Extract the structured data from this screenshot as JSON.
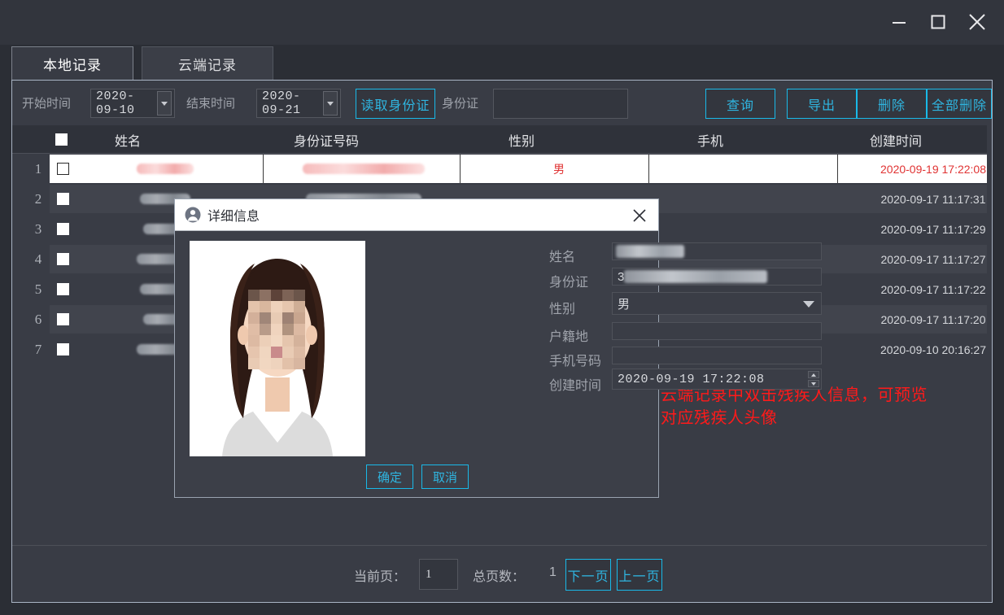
{
  "window": {
    "minimize_label": "—",
    "maximize_label": "□",
    "close_label": "✕"
  },
  "tabs": [
    {
      "label": "本地记录",
      "active": true
    },
    {
      "label": "云端记录",
      "active": false
    }
  ],
  "filter": {
    "start_label": "开始时间",
    "start_value": "2020-09-10",
    "end_label": "结束时间",
    "end_value": "2020-09-21",
    "read_id_button": "读取身份证",
    "idcard_label": "身份证",
    "idcard_value": "",
    "idcard_placeholder": ""
  },
  "toolbar": {
    "query_label": "查询",
    "export_label": "导出",
    "delete_label": "删除",
    "delete_all_label": "全部删除"
  },
  "table": {
    "headers": [
      "姓名",
      "身份证号码",
      "性别",
      "手机",
      "创建时间"
    ],
    "rows": [
      {
        "num": "1",
        "name": "",
        "idcard": "",
        "gender": "男",
        "phone": "",
        "created": "2020-09-19 17:22:08",
        "selected": true
      },
      {
        "num": "2",
        "name": "",
        "idcard": "",
        "gender": "",
        "phone": "",
        "created": "2020-09-17 11:17:31",
        "selected": false
      },
      {
        "num": "3",
        "name": "",
        "idcard": "",
        "gender": "",
        "phone": "",
        "created": "2020-09-17 11:17:29",
        "selected": false
      },
      {
        "num": "4",
        "name": "",
        "idcard": "",
        "gender": "",
        "phone": "",
        "created": "2020-09-17 11:17:27",
        "selected": false
      },
      {
        "num": "5",
        "name": "",
        "idcard": "",
        "gender": "",
        "phone": "",
        "created": "2020-09-17 11:17:22",
        "selected": false
      },
      {
        "num": "6",
        "name": "",
        "idcard": "",
        "gender": "",
        "phone": "",
        "created": "2020-09-17 11:17:20",
        "selected": false
      },
      {
        "num": "7",
        "name": "",
        "idcard": "",
        "gender": "",
        "phone": "",
        "created": "2020-09-10 20:16:27",
        "selected": false
      }
    ]
  },
  "pagination": {
    "current_label": "当前页：",
    "current_value": "1",
    "total_label": "总页数：",
    "total_value": "1",
    "next_label": "下一页",
    "prev_label": "上一页"
  },
  "annotation": {
    "text": "云端记录中双击残疾人信息，可预览\n对应残疾人头像",
    "color": "#ff1a1a"
  },
  "dialog": {
    "title": "详细信息",
    "close_label": "✕",
    "fields": {
      "name_label": "姓名",
      "name_value": "",
      "idcard_label": "身份证",
      "idcard_value": "3",
      "gender_label": "性别",
      "gender_value": "男",
      "domicile_label": "户籍地",
      "domicile_value": "",
      "phone_label": "手机号码",
      "phone_value": "",
      "created_label": "创建时间",
      "created_value": "2020-09-19  17:22:08"
    },
    "ok_label": "确定",
    "cancel_label": "取消"
  },
  "theme": {
    "accent": "#19b9e8",
    "bg": "#2b2e35",
    "panel": "#393c45"
  }
}
